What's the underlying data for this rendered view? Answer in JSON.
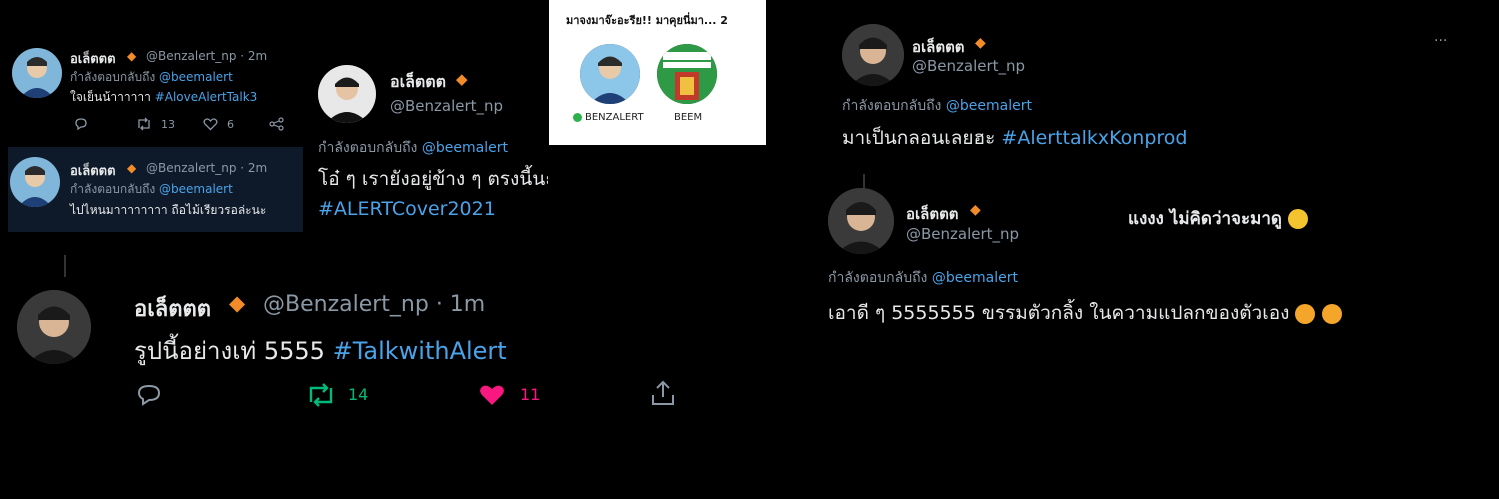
{
  "p1": {
    "t1": {
      "name": "อเล็ตตต",
      "handle": "@Benzalert_np · 2m",
      "reply_prefix": "กำลังตอบกลับถึง",
      "mention": "@beemalert",
      "text": "ใจเย็นน้าาาาาา",
      "tag": "#AloveAlertTalk3",
      "retweets": "13",
      "likes": "6"
    },
    "t2": {
      "name": "อเล็ตตต",
      "handle": "@Benzalert_np · 2m",
      "reply_prefix": "กำลังตอบกลับถึง",
      "mention": "@beemalert",
      "text": "ไปไหนมาาาาาาาา ถือไม้เรียวรอล่ะนะ"
    }
  },
  "p2": {
    "name": "อเล็ตตต",
    "handle": "@Benzalert_np",
    "reply_prefix": "กำลังตอบกลับถึง",
    "mention": "@beemalert",
    "text": "โอ๋ ๆ เรายังอยู่ข้าง ๆ ตรงนี้นะ",
    "tag": "#ALERTCover2021"
  },
  "p3": {
    "title": "มาจงมาจ๊ะอะรีย!! มาคุยนี่มา... 2",
    "user1": "BENZALERT",
    "user2": "BEEM"
  },
  "p4": {
    "name": "อเล็ตตต",
    "handle": "@Benzalert_np · 1m",
    "text": "รูปนี้อย่างเท่ 5555",
    "tag": "#TalkwithAlert",
    "retweets": "14",
    "likes": "11"
  },
  "p5": {
    "t1": {
      "name": "อเล็ตตต",
      "handle": "@Benzalert_np",
      "reply_prefix": "กำลังตอบกลับถึง",
      "mention": "@beemalert",
      "text": "มาเป็นกลอนเลยฮะ",
      "tag": "#AlerttalkxKonprod",
      "more": "···"
    },
    "t2": {
      "name": "อเล็ตตต",
      "handle": "@Benzalert_np",
      "caption": "แงงง ไม่คิดว่าจะมาดู",
      "reply_prefix": "กำลังตอบกลับถึง",
      "mention": "@beemalert",
      "text": "เอาดี ๆ 5555555 ขรรมตัวกลิ้ง ในความแปลกของตัวเอง"
    }
  },
  "colors": {
    "bg": "#000000",
    "link": "#4aa3e8",
    "muted": "#8b98a5",
    "retweet_green": "#00ba7c",
    "like_pink": "#f91880"
  }
}
